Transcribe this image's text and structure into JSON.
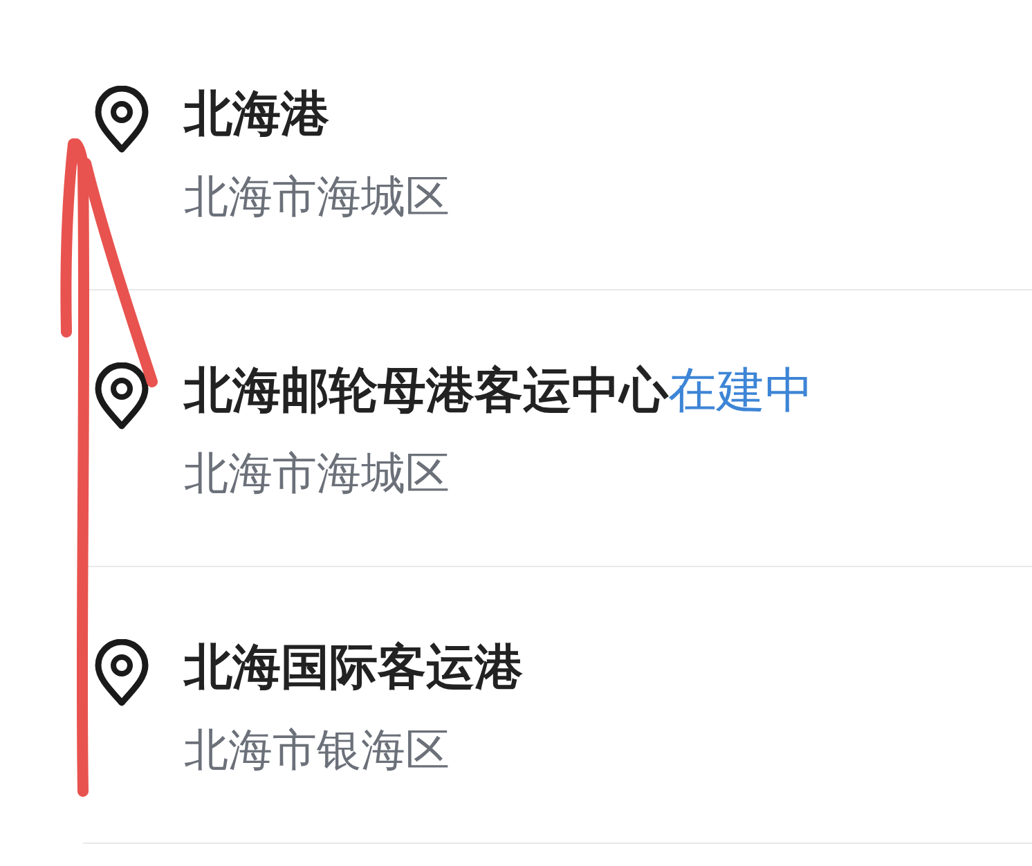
{
  "results": [
    {
      "name": "北海港",
      "address": "北海市海城区"
    },
    {
      "name": "北海邮轮母港客运中心",
      "tag": "在建中",
      "address": "北海市海城区"
    },
    {
      "name": "北海国际客运港",
      "address": "北海市银海区"
    }
  ]
}
